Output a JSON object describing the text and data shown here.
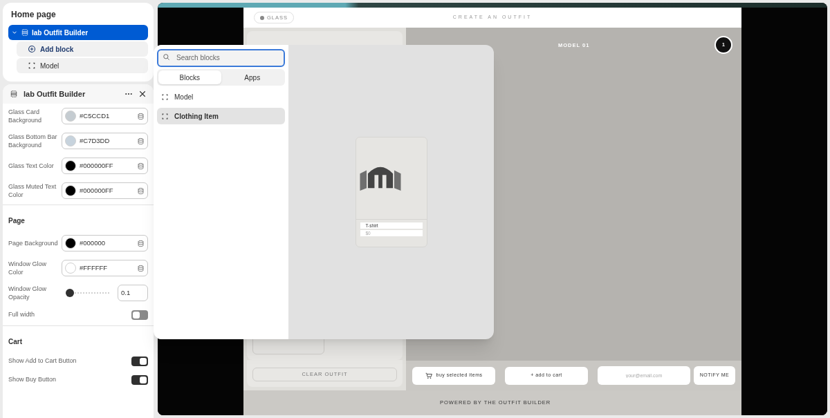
{
  "tree": {
    "title": "Home page",
    "items": [
      {
        "label": "lab Outfit Builder",
        "selected": true,
        "expanded": true,
        "children": [
          {
            "label": "Add block",
            "kind": "add"
          },
          {
            "label": "Model",
            "kind": "block"
          }
        ]
      }
    ]
  },
  "settings": {
    "title": "lab Outfit Builder",
    "fields": [
      {
        "kind": "color",
        "label": "Glass Card Background",
        "value": "#C5CCD1",
        "color": "#c5ccd1"
      },
      {
        "kind": "color",
        "label": "Glass Bottom Bar Background",
        "value": "#C7D3DD",
        "color": "#c7d3dd"
      },
      {
        "kind": "color",
        "label": "Glass Text Color",
        "value": "#000000FF",
        "color": "#000000"
      },
      {
        "kind": "color",
        "label": "Glass Muted Text Color",
        "value": "#000000FF",
        "color": "#000000"
      },
      {
        "kind": "section",
        "label": "Page"
      },
      {
        "kind": "color",
        "label": "Page Background",
        "value": "#000000",
        "color": "#000000"
      },
      {
        "kind": "color",
        "label": "Window Glow Color",
        "value": "#FFFFFF",
        "color": "#ffffff"
      },
      {
        "kind": "slider",
        "label": "Window Glow Opacity",
        "level": 0.08,
        "value": "0.1"
      },
      {
        "kind": "toggle",
        "label": "Full width",
        "on": false
      },
      {
        "kind": "section",
        "label": "Cart"
      },
      {
        "kind": "toggle",
        "label": "Show Add to Cart Button",
        "on": true
      },
      {
        "kind": "toggle",
        "label": "Show Buy Button",
        "on": true
      }
    ]
  },
  "preview": {
    "badge": "GLASS",
    "title": "CREATE AN OUTFIT",
    "model_label": "MODEL 01",
    "count": "1",
    "clear_button": "CLEAR OUTFIT",
    "actions": [
      "buy selected items",
      "+ add to cart"
    ],
    "email_placeholder": "your@email.com",
    "notify_button": "NOTIFY ME",
    "footer": "POWERED BY THE OUTFIT BUILDER"
  },
  "picker": {
    "search_placeholder": "Search blocks",
    "tabs": [
      {
        "label": "Blocks",
        "selected": true
      },
      {
        "label": "Apps",
        "selected": false
      }
    ],
    "items": [
      {
        "label": "Model",
        "selected": false
      },
      {
        "label": "Clothing Item",
        "selected": true
      }
    ],
    "card": {
      "name": "T-shirt",
      "price": "$0"
    }
  }
}
